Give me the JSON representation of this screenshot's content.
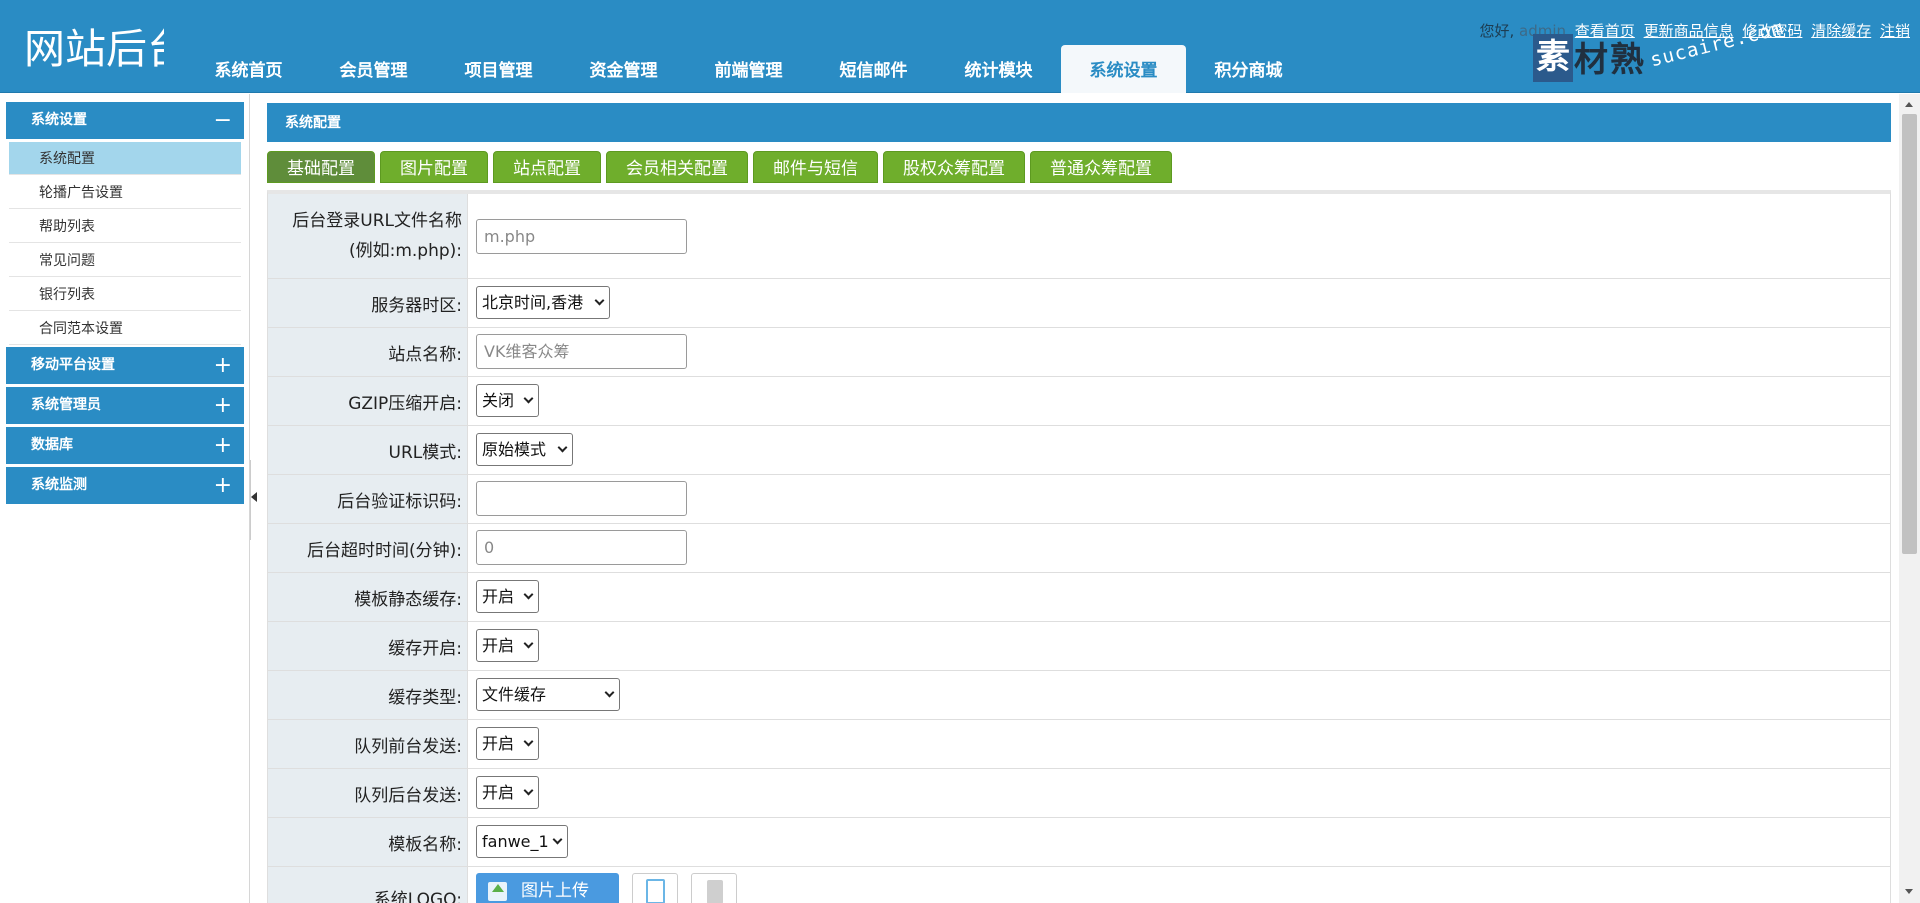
{
  "header": {
    "logo_text": "网站后台",
    "nav": [
      {
        "label": "系统首页"
      },
      {
        "label": "会员管理"
      },
      {
        "label": "项目管理"
      },
      {
        "label": "资金管理"
      },
      {
        "label": "前端管理"
      },
      {
        "label": "短信邮件"
      },
      {
        "label": "统计模块"
      },
      {
        "label": "系统设置",
        "active": true
      },
      {
        "label": "积分商城"
      }
    ],
    "greeting": "您好,",
    "username": "admin",
    "links": [
      "查看首页",
      "更新商品信息",
      "修改密码",
      "清除缓存",
      "注销"
    ]
  },
  "watermark": {
    "badge": "素",
    "title": "材熟",
    "url": "sucaire.com"
  },
  "sidebar": {
    "groups": [
      {
        "label": "系统设置",
        "toggle": "−",
        "items": [
          "系统配置",
          "轮播广告设置",
          "帮助列表",
          "常见问题",
          "银行列表",
          "合同范本设置"
        ]
      },
      {
        "label": "移动平台设置",
        "toggle": "+"
      },
      {
        "label": "系统管理员",
        "toggle": "+"
      },
      {
        "label": "数据库",
        "toggle": "+"
      },
      {
        "label": "系统监测",
        "toggle": "+"
      }
    ]
  },
  "main": {
    "title": "系统配置",
    "tabs": [
      "基础配置",
      "图片配置",
      "站点配置",
      "会员相关配置",
      "邮件与短信",
      "股权众筹配置",
      "普通众筹配置"
    ],
    "fields": [
      {
        "label": "后台登录URL文件名称",
        "label2": "(例如:m.php):",
        "type": "text",
        "value": "m.php"
      },
      {
        "label": "服务器时区:",
        "type": "select",
        "value": "北京时间,香港"
      },
      {
        "label": "站点名称:",
        "type": "text",
        "value": "VK维客众筹"
      },
      {
        "label": "GZIP压缩开启:",
        "type": "select",
        "value": "关闭"
      },
      {
        "label": "URL模式:",
        "type": "select",
        "value": "原始模式"
      },
      {
        "label": "后台验证标识码:",
        "type": "text",
        "value": ""
      },
      {
        "label": "后台超时时间(分钟):",
        "type": "text",
        "value": "0"
      },
      {
        "label": "模板静态缓存:",
        "type": "select",
        "value": "开启"
      },
      {
        "label": "缓存开启:",
        "type": "select",
        "value": "开启"
      },
      {
        "label": "缓存类型:",
        "type": "select",
        "value": "文件缓存"
      },
      {
        "label": "队列前台发送:",
        "type": "select",
        "value": "开启"
      },
      {
        "label": "队列后台发送:",
        "type": "select",
        "value": "开启"
      },
      {
        "label": "模板名称:",
        "type": "select",
        "value": "fanwe_1"
      },
      {
        "label": "系统LOGO:",
        "type": "upload",
        "value": "图片上传"
      }
    ]
  }
}
